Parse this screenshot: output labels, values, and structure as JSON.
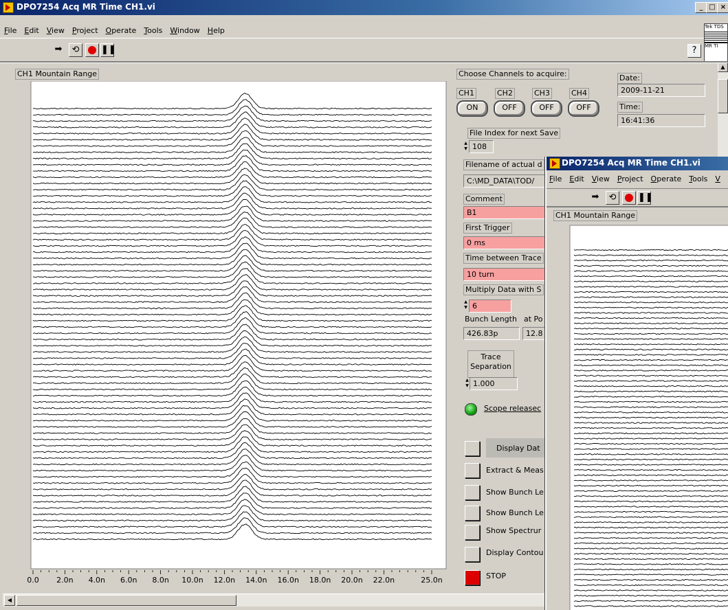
{
  "window": {
    "title": "DPO7254 Acq MR Time CH1.vi",
    "menu": [
      "File",
      "Edit",
      "View",
      "Project",
      "Operate",
      "Tools",
      "Window",
      "Help"
    ],
    "context_help": "?",
    "scope_icon_lines": [
      "Tek TDS",
      "MR TI"
    ]
  },
  "graph": {
    "label": "CH1 Mountain Range",
    "x_ticks": [
      "0.0",
      "2.0n",
      "4.0n",
      "6.0n",
      "8.0n",
      "10.0n",
      "12.0n",
      "14.0n",
      "16.0n",
      "18.0n",
      "20.0n",
      "22.0n",
      "25.0n"
    ]
  },
  "chart_data": {
    "type": "line",
    "title": "CH1 Mountain Range",
    "xlabel": "",
    "ylabel": "",
    "xlim": [
      0,
      2.5e-08
    ],
    "x_tick_labels": [
      "0.0",
      "2.0n",
      "4.0n",
      "6.0n",
      "8.0n",
      "10.0n",
      "12.0n",
      "14.0n",
      "16.0n",
      "18.0n",
      "20.0n",
      "22.0n",
      "25.0n"
    ],
    "trace_count": 70,
    "pulse_center_ns": 13.3,
    "pulse_width_ns": 0.43,
    "grid": false
  },
  "panel": {
    "channels_label": "Choose Channels to acquire:",
    "channels": [
      {
        "name": "CH1",
        "state": "ON"
      },
      {
        "name": "CH2",
        "state": "OFF"
      },
      {
        "name": "CH3",
        "state": "OFF"
      },
      {
        "name": "CH4",
        "state": "OFF"
      }
    ],
    "date_label": "Date:",
    "date_value": "2009-11-21",
    "time_label": "Time:",
    "time_value": "16:41:36",
    "file_index_label": "File Index for next Save",
    "file_index_value": "108",
    "filename_label": "Filename of actual d",
    "filename_value": "C:\\MD_DATA\\TOD/",
    "comment_label": "Comment",
    "comment_value": "B1",
    "first_trigger_label": "First Trigger",
    "first_trigger_value": "0 ms",
    "time_between_label": "Time between Trace",
    "time_between_value": "10 turn",
    "multiply_label": "Multiply Data with S",
    "multiply_value": "6",
    "bunch_length_label": "Bunch Length",
    "bunch_length_value": "426.83p",
    "at_pos_label": "at Po",
    "at_pos_value": "12.8",
    "trace_sep_label_1": "Trace",
    "trace_sep_label_2": "Separation",
    "trace_sep_value": "1.000",
    "scope_status": "Scope releasec",
    "buttons": [
      "Display Dat",
      "Extract & Meas",
      "Show Bunch Le",
      "Show Bunch Le",
      "Show Spectrur",
      "Display Contou"
    ],
    "stop_label": "STOP"
  },
  "second_window": {
    "title": "DPO7254 Acq MR Time CH1.vi",
    "menu": [
      "File",
      "Edit",
      "View",
      "Project",
      "Operate",
      "Tools",
      "V"
    ],
    "graph_label": "CH1 Mountain Range"
  }
}
